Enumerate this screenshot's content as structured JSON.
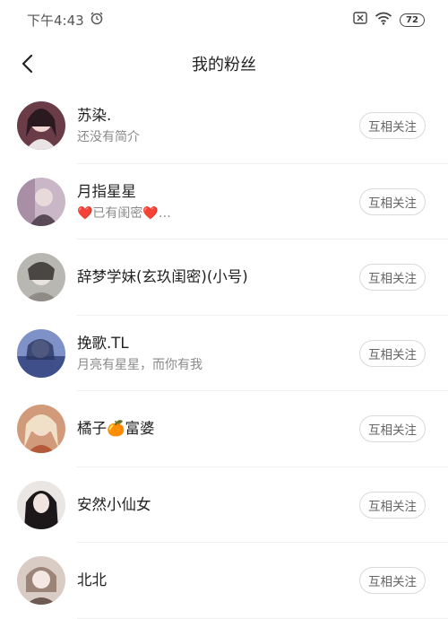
{
  "status_bar": {
    "time": "下午4:43",
    "battery": "72",
    "icons": [
      "alarm-icon",
      "sim-icon",
      "wifi-icon",
      "battery-icon"
    ]
  },
  "nav": {
    "title": "我的粉丝",
    "back_icon": "chevron-left-icon"
  },
  "fans": [
    {
      "name": "苏染.",
      "bio": "还没有简介",
      "button": "互相关注",
      "avatar_color": "#6a3c48"
    },
    {
      "name": "月指星星",
      "bio": "❤️已有闺密❤️…",
      "button": "互相关注",
      "avatar_color": "#c9b7c7"
    },
    {
      "name": "辞梦学妹(玄玖闺密)(小号)",
      "bio": "",
      "button": "互相关注",
      "avatar_color": "#9a9a96"
    },
    {
      "name": "挽歌.TL",
      "bio": "月亮有星星，而你有我",
      "button": "互相关注",
      "avatar_color": "#7f92c8"
    },
    {
      "name": "橘子🍊富婆",
      "bio": "",
      "button": "互相关注",
      "avatar_color": "#d19a7a"
    },
    {
      "name": "安然小仙女",
      "bio": "",
      "button": "互相关注",
      "avatar_color": "#3a3435"
    },
    {
      "name": "北北",
      "bio": "",
      "button": "互相关注",
      "avatar_color": "#c8b4a8"
    }
  ],
  "colors": {
    "divider": "#efefef",
    "button_border": "#d9d9d9",
    "secondary_text": "#8a8a8a"
  }
}
